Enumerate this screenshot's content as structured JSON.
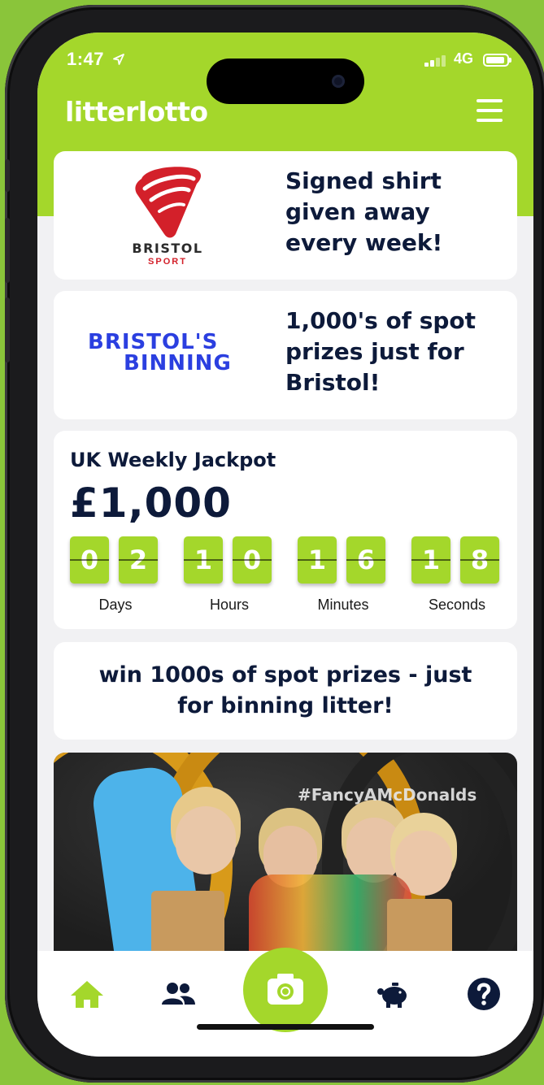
{
  "status_bar": {
    "time": "1:47",
    "network": "4G"
  },
  "header": {
    "logo": "litterlotto"
  },
  "promo_cards": [
    {
      "logo_word": "BRISTOL",
      "logo_sub": "SPORT",
      "text_lines": [
        "Signed shirt",
        "given away",
        "every week!"
      ]
    },
    {
      "logo_lines": [
        "BRISTOL'S",
        "BINNING"
      ],
      "text_lines": [
        "1,000's of spot",
        "prizes just for",
        "Bristol!"
      ]
    }
  ],
  "jackpot": {
    "title": "UK Weekly Jackpot",
    "amount": "£1,000",
    "countdown": [
      {
        "digits": [
          "0",
          "2"
        ],
        "label": "Days"
      },
      {
        "digits": [
          "1",
          "0"
        ],
        "label": "Hours"
      },
      {
        "digits": [
          "1",
          "6"
        ],
        "label": "Minutes"
      },
      {
        "digits": [
          "1",
          "8"
        ],
        "label": "Seconds"
      }
    ]
  },
  "win_banner": {
    "lines": [
      "win 1000s of spot prizes - just",
      "for binning litter!"
    ]
  },
  "photo": {
    "hashtag": "#FancyAMcDonalds"
  },
  "colors": {
    "brand_green": "#a4d72b",
    "navy": "#0d1a3a",
    "bristol_red": "#d3202a",
    "binning_blue": "#2b3fe0"
  },
  "nav": {
    "items": [
      "home-icon",
      "users-icon",
      "camera-icon",
      "piggy-bank-icon",
      "help-icon"
    ],
    "active": "home-icon"
  }
}
